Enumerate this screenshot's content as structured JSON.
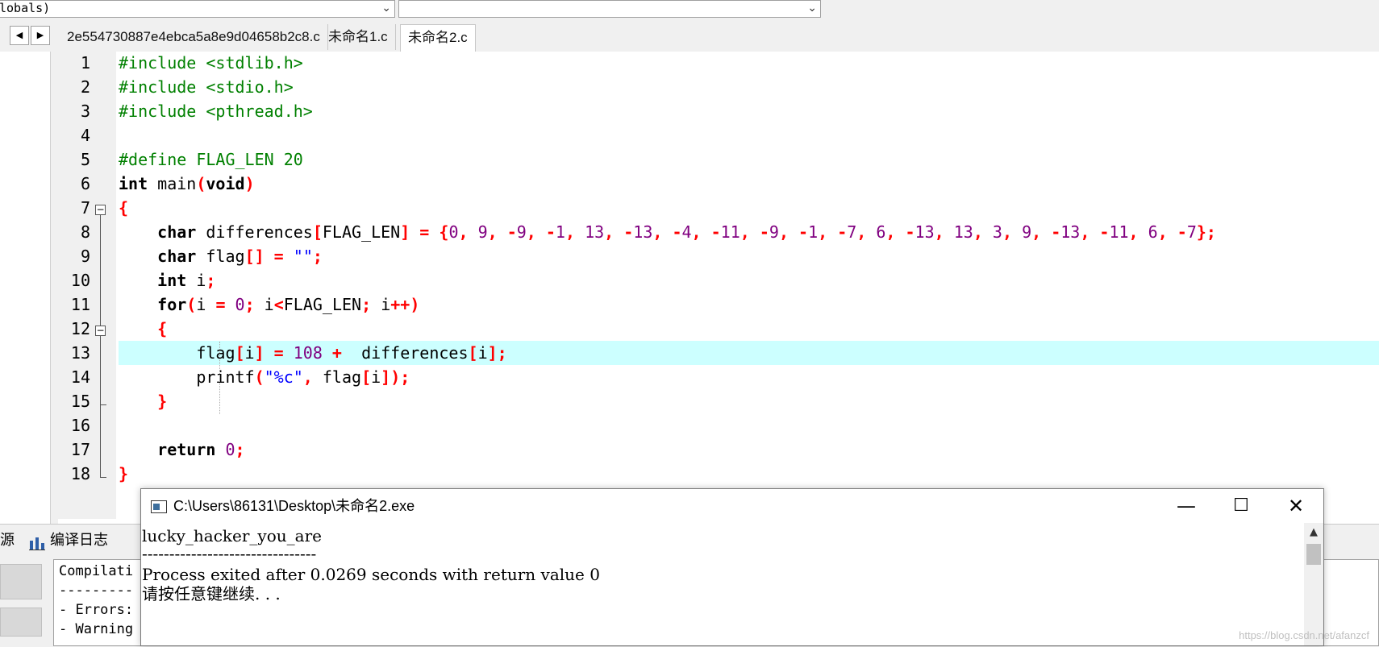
{
  "toolbar": {
    "scope_combo": "lobals)",
    "symbol_combo": ""
  },
  "tabs": [
    {
      "label": "2e554730887e4ebca5a8e9d04658b2c8.c",
      "active": false
    },
    {
      "label": "未命名1.c",
      "active": false
    },
    {
      "label": "未命名2.c",
      "active": true
    }
  ],
  "nav": {
    "prev": "◀",
    "next": "▶"
  },
  "editor": {
    "highlighted_line": 13,
    "lines": [
      {
        "n": "1",
        "tokens": [
          {
            "t": "#include <stdlib.h>",
            "c": "pp"
          }
        ]
      },
      {
        "n": "2",
        "tokens": [
          {
            "t": "#include <stdio.h>",
            "c": "pp"
          }
        ]
      },
      {
        "n": "3",
        "tokens": [
          {
            "t": "#include <pthread.h>",
            "c": "pp"
          }
        ]
      },
      {
        "n": "4",
        "tokens": []
      },
      {
        "n": "5",
        "tokens": [
          {
            "t": "#define FLAG_LEN 20",
            "c": "pp"
          }
        ]
      },
      {
        "n": "6",
        "tokens": [
          {
            "t": "int",
            "c": "kw"
          },
          {
            "t": " main",
            "c": ""
          },
          {
            "t": "(",
            "c": "op"
          },
          {
            "t": "void",
            "c": "kw"
          },
          {
            "t": ")",
            "c": "op"
          }
        ]
      },
      {
        "n": "7",
        "tokens": [
          {
            "t": "{",
            "c": "op"
          }
        ]
      },
      {
        "n": "8",
        "tokens": [
          {
            "t": "    ",
            "c": ""
          },
          {
            "t": "char",
            "c": "kw"
          },
          {
            "t": " differences",
            "c": ""
          },
          {
            "t": "[",
            "c": "op"
          },
          {
            "t": "FLAG_LEN",
            "c": ""
          },
          {
            "t": "] = {",
            "c": "op"
          },
          {
            "t": "0",
            "c": "num"
          },
          {
            "t": ", ",
            "c": "op"
          },
          {
            "t": "9",
            "c": "num"
          },
          {
            "t": ", -",
            "c": "op"
          },
          {
            "t": "9",
            "c": "num"
          },
          {
            "t": ", -",
            "c": "op"
          },
          {
            "t": "1",
            "c": "num"
          },
          {
            "t": ", ",
            "c": "op"
          },
          {
            "t": "13",
            "c": "num"
          },
          {
            "t": ", -",
            "c": "op"
          },
          {
            "t": "13",
            "c": "num"
          },
          {
            "t": ", -",
            "c": "op"
          },
          {
            "t": "4",
            "c": "num"
          },
          {
            "t": ", -",
            "c": "op"
          },
          {
            "t": "11",
            "c": "num"
          },
          {
            "t": ", -",
            "c": "op"
          },
          {
            "t": "9",
            "c": "num"
          },
          {
            "t": ", -",
            "c": "op"
          },
          {
            "t": "1",
            "c": "num"
          },
          {
            "t": ", -",
            "c": "op"
          },
          {
            "t": "7",
            "c": "num"
          },
          {
            "t": ", ",
            "c": "op"
          },
          {
            "t": "6",
            "c": "num"
          },
          {
            "t": ", -",
            "c": "op"
          },
          {
            "t": "13",
            "c": "num"
          },
          {
            "t": ", ",
            "c": "op"
          },
          {
            "t": "13",
            "c": "num"
          },
          {
            "t": ", ",
            "c": "op"
          },
          {
            "t": "3",
            "c": "num"
          },
          {
            "t": ", ",
            "c": "op"
          },
          {
            "t": "9",
            "c": "num"
          },
          {
            "t": ", -",
            "c": "op"
          },
          {
            "t": "13",
            "c": "num"
          },
          {
            "t": ", -",
            "c": "op"
          },
          {
            "t": "11",
            "c": "num"
          },
          {
            "t": ", ",
            "c": "op"
          },
          {
            "t": "6",
            "c": "num"
          },
          {
            "t": ", -",
            "c": "op"
          },
          {
            "t": "7",
            "c": "num"
          },
          {
            "t": "};",
            "c": "op"
          }
        ]
      },
      {
        "n": "9",
        "tokens": [
          {
            "t": "    ",
            "c": ""
          },
          {
            "t": "char",
            "c": "kw"
          },
          {
            "t": " flag",
            "c": ""
          },
          {
            "t": "[] = ",
            "c": "op"
          },
          {
            "t": "\"\"",
            "c": "str"
          },
          {
            "t": ";",
            "c": "op"
          }
        ]
      },
      {
        "n": "10",
        "tokens": [
          {
            "t": "    ",
            "c": ""
          },
          {
            "t": "int",
            "c": "kw"
          },
          {
            "t": " i",
            "c": ""
          },
          {
            "t": ";",
            "c": "op"
          }
        ]
      },
      {
        "n": "11",
        "tokens": [
          {
            "t": "    ",
            "c": ""
          },
          {
            "t": "for",
            "c": "kw"
          },
          {
            "t": "(",
            "c": "op"
          },
          {
            "t": "i ",
            "c": ""
          },
          {
            "t": "= ",
            "c": "op"
          },
          {
            "t": "0",
            "c": "num"
          },
          {
            "t": "; ",
            "c": "op"
          },
          {
            "t": "i",
            "c": ""
          },
          {
            "t": "<",
            "c": "op"
          },
          {
            "t": "FLAG_LEN",
            "c": ""
          },
          {
            "t": "; ",
            "c": "op"
          },
          {
            "t": "i",
            "c": ""
          },
          {
            "t": "++)",
            "c": "op"
          }
        ]
      },
      {
        "n": "12",
        "tokens": [
          {
            "t": "    ",
            "c": ""
          },
          {
            "t": "{",
            "c": "op"
          }
        ]
      },
      {
        "n": "13",
        "tokens": [
          {
            "t": "        flag",
            "c": ""
          },
          {
            "t": "[",
            "c": "op"
          },
          {
            "t": "i",
            "c": ""
          },
          {
            "t": "] = ",
            "c": "op"
          },
          {
            "t": "108",
            "c": "num"
          },
          {
            "t": " +  ",
            "c": "op"
          },
          {
            "t": "differences",
            "c": ""
          },
          {
            "t": "[",
            "c": "op"
          },
          {
            "t": "i",
            "c": ""
          },
          {
            "t": "];",
            "c": "op"
          }
        ]
      },
      {
        "n": "14",
        "tokens": [
          {
            "t": "        printf",
            "c": ""
          },
          {
            "t": "(",
            "c": "op"
          },
          {
            "t": "\"%c\"",
            "c": "str"
          },
          {
            "t": ", ",
            "c": "op"
          },
          {
            "t": "flag",
            "c": ""
          },
          {
            "t": "[",
            "c": "op"
          },
          {
            "t": "i",
            "c": ""
          },
          {
            "t": "]);",
            "c": "op"
          }
        ]
      },
      {
        "n": "15",
        "tokens": [
          {
            "t": "    ",
            "c": ""
          },
          {
            "t": "}",
            "c": "op"
          }
        ]
      },
      {
        "n": "16",
        "tokens": []
      },
      {
        "n": "17",
        "tokens": [
          {
            "t": "    ",
            "c": ""
          },
          {
            "t": "return",
            "c": "kw"
          },
          {
            "t": " ",
            "c": ""
          },
          {
            "t": "0",
            "c": "num"
          },
          {
            "t": ";",
            "c": "op"
          }
        ]
      },
      {
        "n": "18",
        "tokens": [
          {
            "t": "}",
            "c": "op"
          }
        ]
      }
    ]
  },
  "bottom_tabs": {
    "source_label": "源",
    "compile_log_label": "编译日志"
  },
  "compile_log": {
    "lines": [
      "Compilati",
      "---------",
      "- Errors:",
      "- Warning"
    ]
  },
  "console": {
    "title": "C:\\Users\\86131\\Desktop\\未命名2.exe",
    "minimize": "—",
    "maximize": "☐",
    "close": "✕",
    "output": [
      "lucky_hacker_you_are",
      "--------------------------------",
      "Process exited after 0.0269 seconds with return value 0",
      "请按任意键继续. . ."
    ]
  },
  "watermark": "https://blog.csdn.net/afanzcf"
}
